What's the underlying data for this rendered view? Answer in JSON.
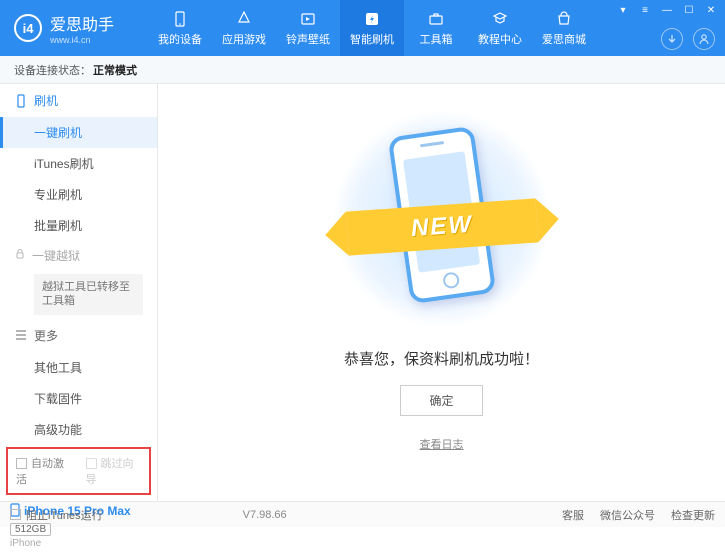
{
  "app": {
    "name": "爱思助手",
    "url": "www.i4.cn"
  },
  "topnav": {
    "items": [
      {
        "label": "我的设备"
      },
      {
        "label": "应用游戏"
      },
      {
        "label": "铃声壁纸"
      },
      {
        "label": "智能刷机"
      },
      {
        "label": "工具箱"
      },
      {
        "label": "教程中心"
      },
      {
        "label": "爱思商城"
      }
    ],
    "active_index": 3
  },
  "status": {
    "label": "设备连接状态：",
    "value": "正常模式"
  },
  "sidebar": {
    "flash": {
      "title": "刷机",
      "items": [
        "一键刷机",
        "iTunes刷机",
        "专业刷机",
        "批量刷机"
      ],
      "active_index": 0
    },
    "jailbreak": {
      "title": "一键越狱",
      "note": "越狱工具已转移至工具箱"
    },
    "more": {
      "title": "更多",
      "items": [
        "其他工具",
        "下载固件",
        "高级功能"
      ]
    },
    "options": {
      "auto_activate": "自动激活",
      "skip_guide": "跳过向导"
    }
  },
  "device": {
    "name": "iPhone 15 Pro Max",
    "storage": "512GB",
    "type": "iPhone"
  },
  "main": {
    "ribbon": "NEW",
    "success": "恭喜您，保资料刷机成功啦！",
    "ok": "确定",
    "log": "查看日志"
  },
  "footer": {
    "block_itunes": "阻止iTunes运行",
    "version": "V7.98.66",
    "links": [
      "客服",
      "微信公众号",
      "检查更新"
    ]
  }
}
